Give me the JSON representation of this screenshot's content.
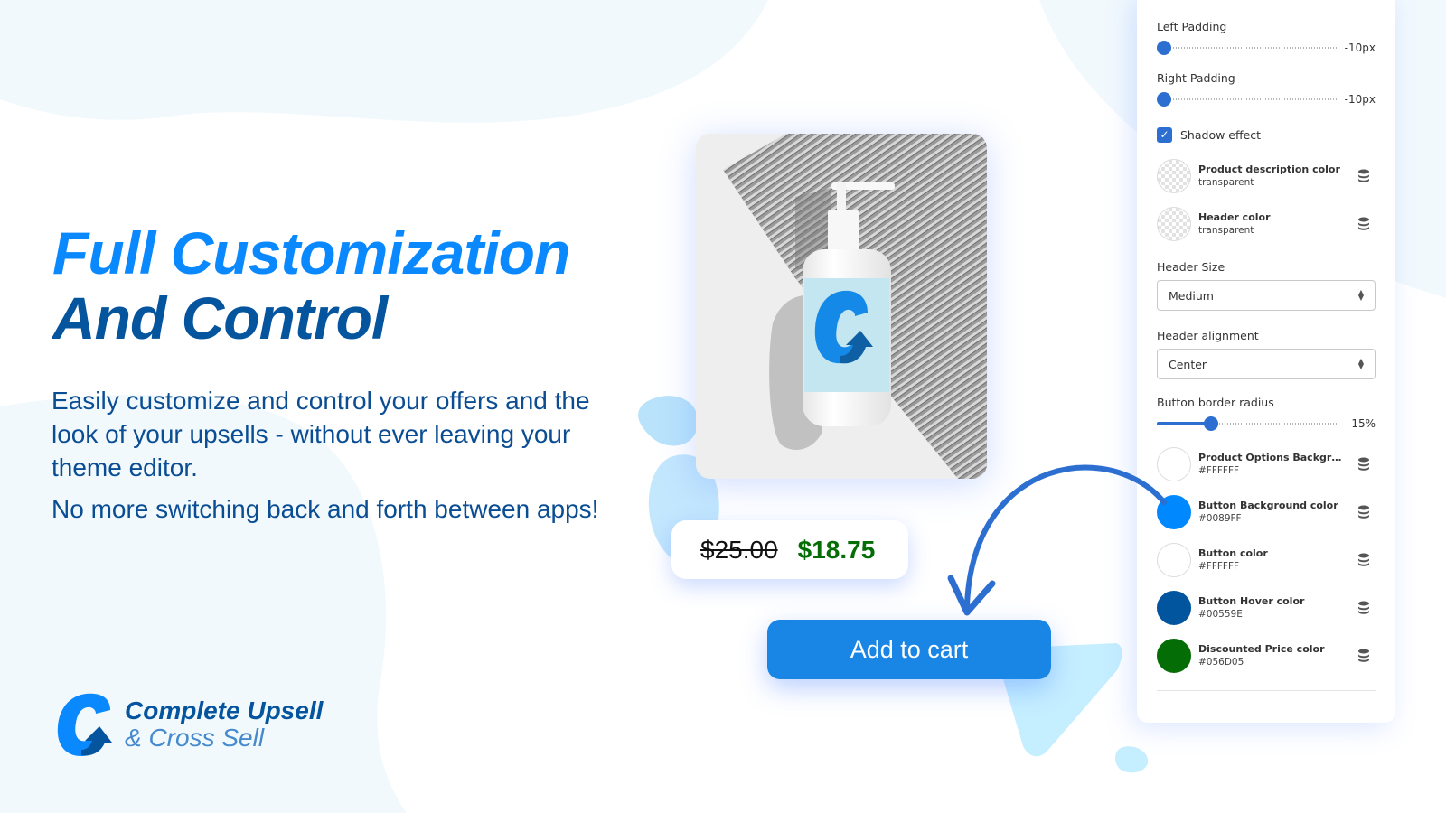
{
  "headline": {
    "line1": "Full Customization",
    "line2": "And Control"
  },
  "description": {
    "paragraph1": "Easily customize and control your offers and the look of your upsells - without ever leaving your theme editor.",
    "paragraph2": "No more switching back and forth between apps!"
  },
  "brand": {
    "name": "Complete Upsell",
    "tagline": "& Cross Sell",
    "logo_icon": "c-arrow-logo-icon"
  },
  "preview": {
    "product_image": "soap-bottle-product-image",
    "price_original": "$25.00",
    "price_discounted": "$18.75",
    "add_to_cart_label": "Add to cart"
  },
  "panel": {
    "left_padding": {
      "label": "Left Padding",
      "value_text": "-10px",
      "fraction": 0.0
    },
    "right_padding": {
      "label": "Right Padding",
      "value_text": "-10px",
      "fraction": 0.0
    },
    "shadow_effect": {
      "label": "Shadow effect",
      "checked": true
    },
    "colors_top": [
      {
        "name": "Product description color",
        "value": "transparent",
        "swatch": "transparent"
      },
      {
        "name": "Header color",
        "value": "transparent",
        "swatch": "transparent"
      }
    ],
    "header_size": {
      "label": "Header Size",
      "selected": "Medium"
    },
    "header_alignment": {
      "label": "Header alignment",
      "selected": "Center"
    },
    "button_border_radius": {
      "label": "Button border radius",
      "value_text": "15%",
      "fraction": 0.3
    },
    "colors_bottom": [
      {
        "name": "Product Options Background ...",
        "value": "#FFFFFF",
        "swatch": "#FFFFFF"
      },
      {
        "name": "Button Background color",
        "value": "#0089FF",
        "swatch": "#0089FF"
      },
      {
        "name": "Button color",
        "value": "#FFFFFF",
        "swatch": "#FFFFFF"
      },
      {
        "name": "Button Hover color",
        "value": "#00559E",
        "swatch": "#00559E"
      },
      {
        "name": "Discounted Price color",
        "value": "#056D05",
        "swatch": "#056D05"
      }
    ],
    "reset_icon": "database-icon"
  },
  "colors": {
    "headline_primary": "#0A89FF",
    "headline_secondary": "#05549E",
    "body_text": "#0A4D93",
    "cart_button": "#1985E4",
    "arrow": "#2C6FD1",
    "accent_blob": "#C5EEFF"
  }
}
